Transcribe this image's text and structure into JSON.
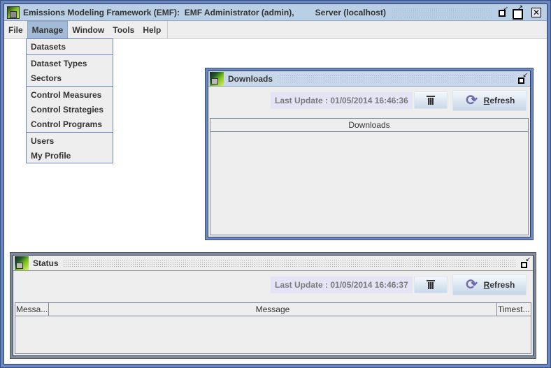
{
  "window": {
    "title": "Emissions Modeling Framework (EMF):  EMF Administrator (admin),",
    "server": "Server (localhost)"
  },
  "menu_bar": {
    "items": [
      {
        "label": "File"
      },
      {
        "label": "Manage",
        "active": true
      },
      {
        "label": "Window"
      },
      {
        "label": "Tools"
      },
      {
        "label": "Help"
      }
    ]
  },
  "manage_menu": {
    "groups": [
      [
        "Datasets"
      ],
      [
        "Dataset Types",
        "Sectors"
      ],
      [
        "Control Measures",
        "Control Strategies",
        "Control Programs"
      ],
      [
        "Users",
        "My Profile"
      ]
    ],
    "items": {
      "datasets": "Datasets",
      "dataset_types": "Dataset Types",
      "sectors": "Sectors",
      "control_measures": "Control Measures",
      "control_strategies": "Control Strategies",
      "control_programs": "Control Programs",
      "users": "Users",
      "my_profile": "My Profile"
    }
  },
  "downloads_window": {
    "title": "Downloads",
    "last_update": "Last Update : 01/05/2014 16:46:36",
    "refresh_label_mnemonic": "R",
    "refresh_label_rest": "efresh",
    "table_columns": [
      "Downloads"
    ]
  },
  "status_window": {
    "title": "Status",
    "last_update": "Last Update : 01/05/2014 16:46:37",
    "refresh_label_mnemonic": "R",
    "refresh_label_rest": "efresh",
    "table_columns": [
      "Messa...",
      "Message",
      "Timest..."
    ]
  },
  "colors": {
    "frame_active": "#6a87c5",
    "title_bar": "#b8cfe5",
    "menu_highlight": "#a3bbd6",
    "last_update_bg": "#e4e4f6"
  }
}
